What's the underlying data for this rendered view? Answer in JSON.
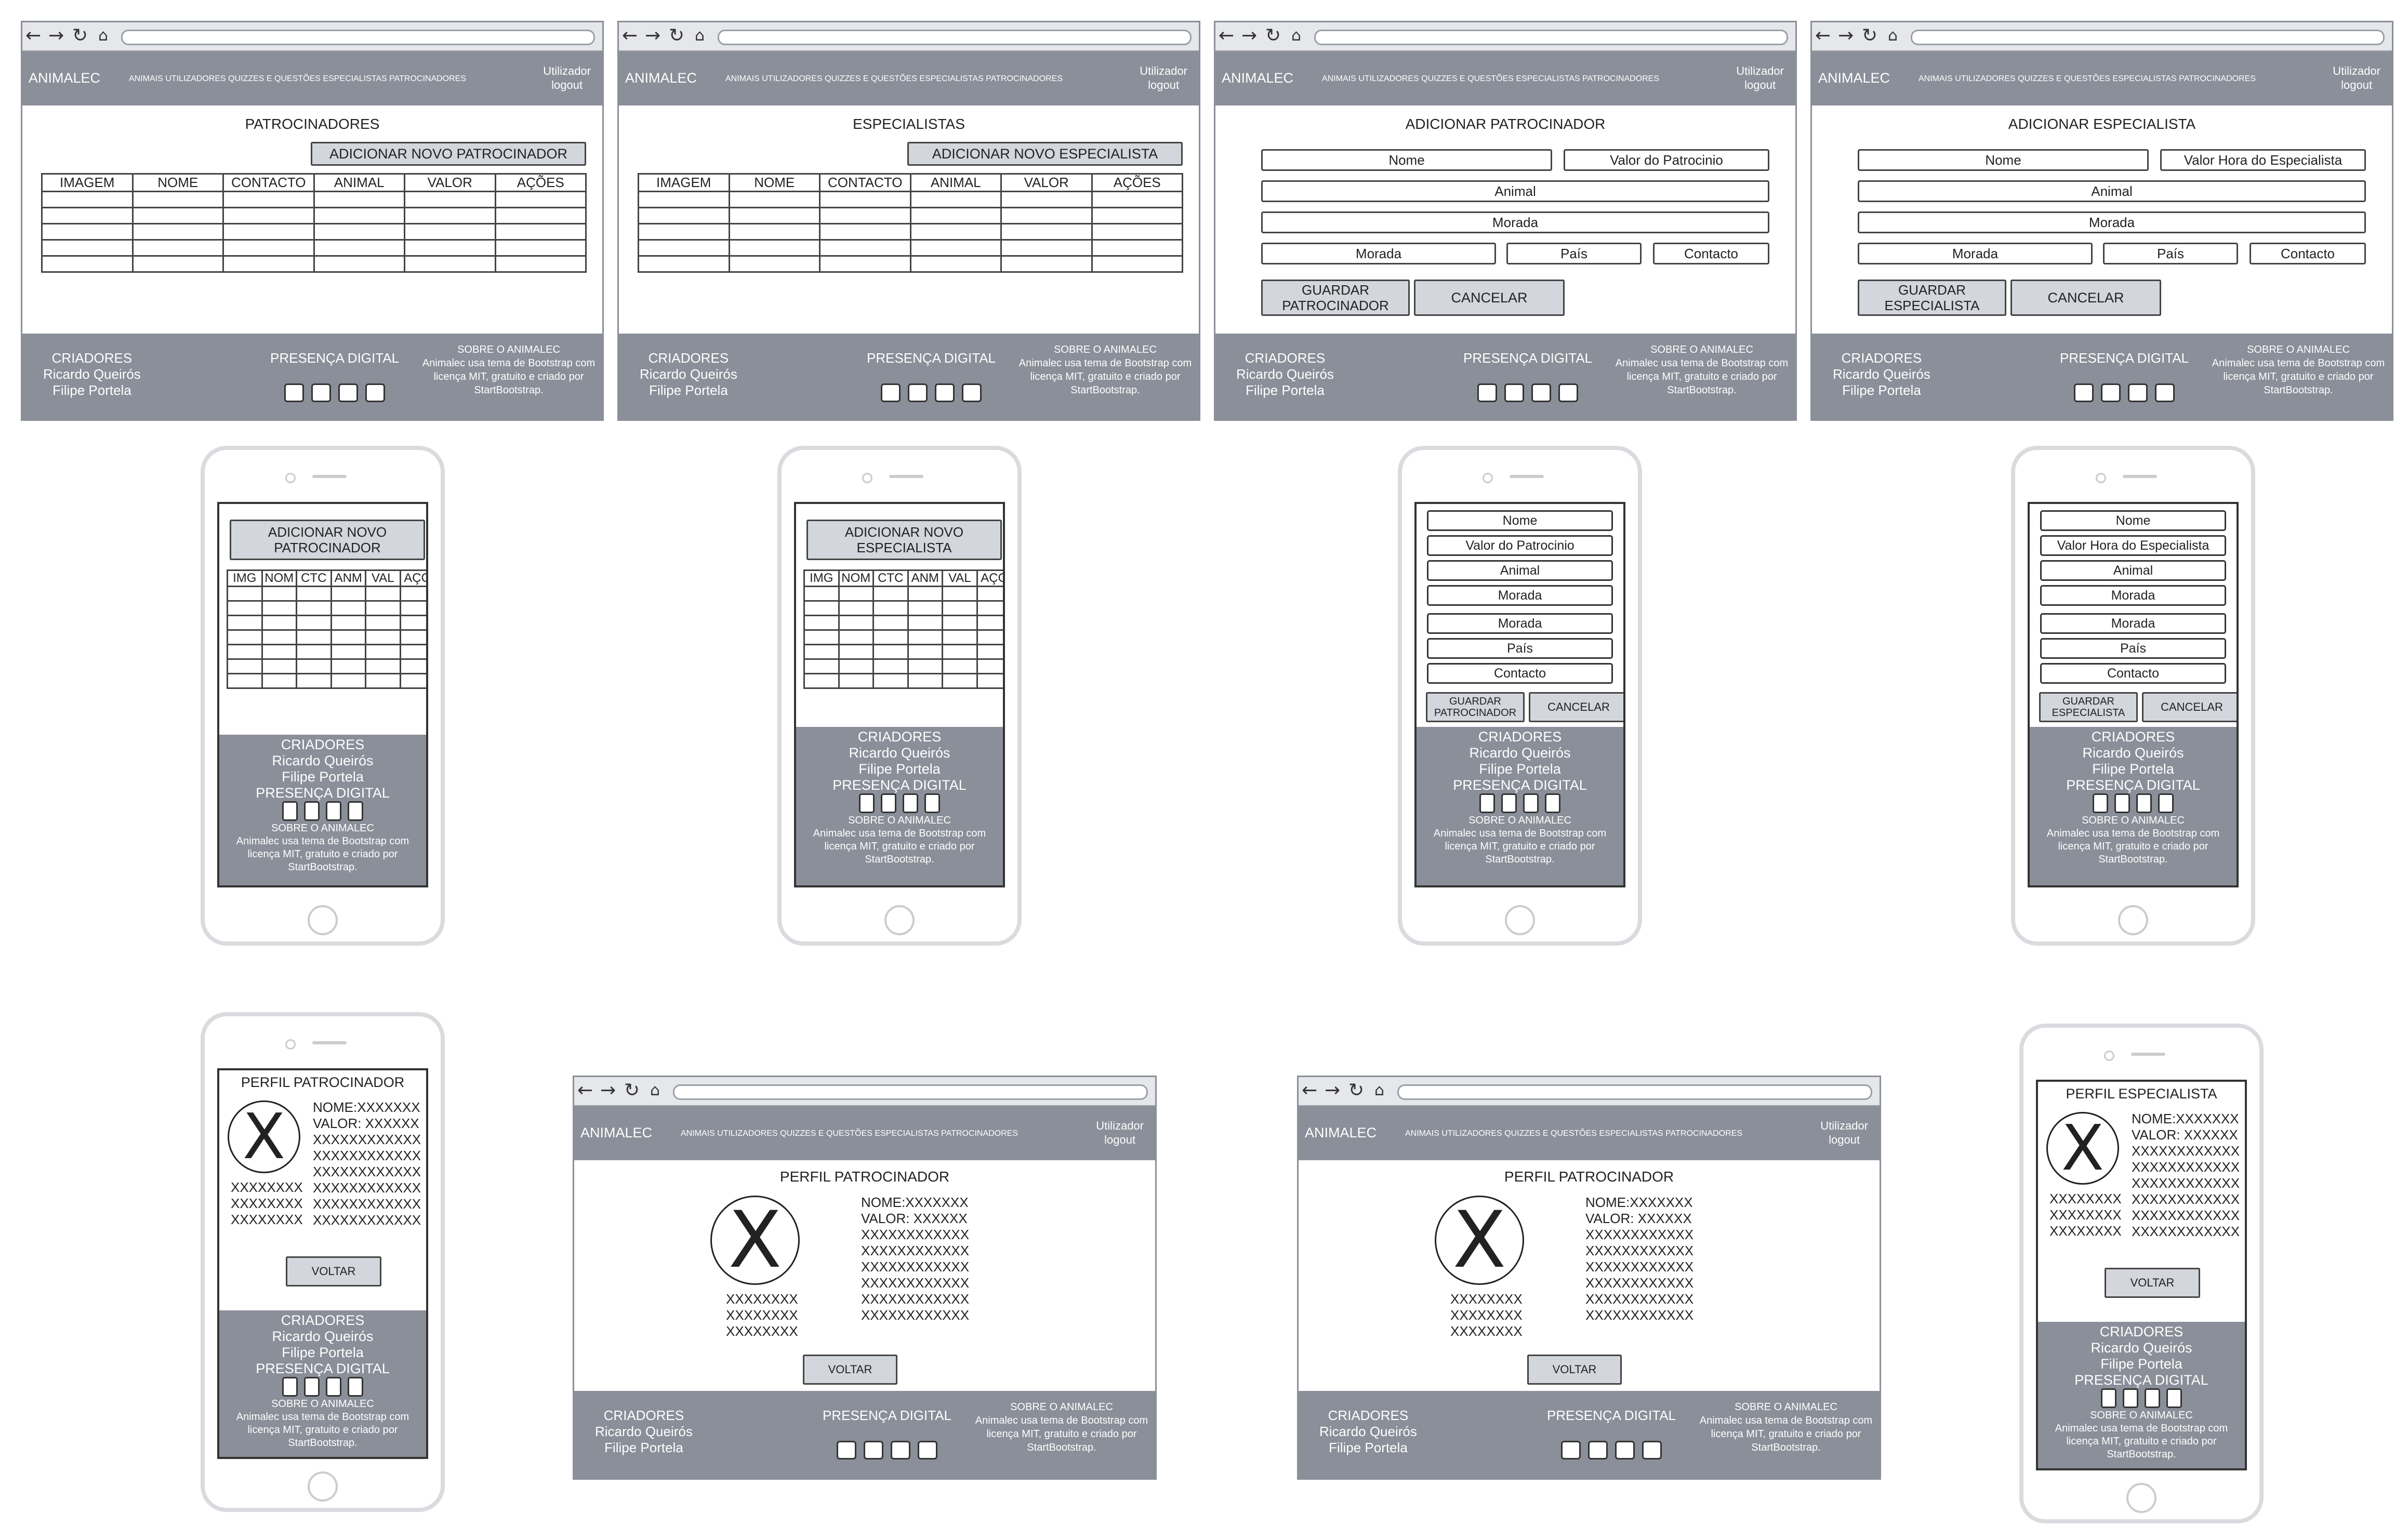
{
  "nav": {
    "brand": "ANIMALEC",
    "menu": "ANIMAIS UTILIZADORES QUIZZES E QUESTÕES ESPECIALISTAS PATROCINADORES",
    "user": "Utilizador",
    "logout": "logout"
  },
  "footer": {
    "criadores": "CRIADORES",
    "author1": "Ricardo Queirós",
    "author2": "Filipe Portela",
    "presenca": "PRESENÇA DIGITAL",
    "sobre": "SOBRE O ANIMALEC",
    "sobre_text": "Animalec usa tema de Bootstrap com licença MIT, gratuito e criado por StartBootstrap."
  },
  "sponsors_list": {
    "title": "PATROCINADORES",
    "add_button": "ADICIONAR NOVO PATROCINADOR",
    "mobile_add_button": "ADICIONAR NOVO PATROCINADOR"
  },
  "experts_list": {
    "title": "ESPECIALISTAS",
    "add_button": "ADICIONAR NOVO ESPECIALISTA",
    "mobile_add_button": "ADICIONAR NOVO ESPECIALISTA"
  },
  "table_headers": [
    "IMAGEM",
    "NOME",
    "CONTACTO",
    "ANIMAL",
    "VALOR",
    "AÇÕES"
  ],
  "mobile_table_headers": [
    "IMG",
    "NOM",
    "CTC",
    "ANM",
    "VAL",
    "AÇO"
  ],
  "add_sponsor": {
    "title": "ADICIONAR PATROCINADOR",
    "nome": "Nome",
    "valor": "Valor do Patrocinio",
    "animal": "Animal",
    "morada": "Morada",
    "morada2": "Morada",
    "pais": "País",
    "contacto": "Contacto",
    "save": "GUARDAR PATROCINADOR",
    "cancel": "CANCELAR"
  },
  "add_expert": {
    "title": "ADICIONAR ESPECIALISTA",
    "nome": "Nome",
    "valor": "Valor Hora do Especialista",
    "animal": "Animal",
    "morada": "Morada",
    "morada2": "Morada",
    "pais": "País",
    "contacto": "Contacto",
    "save": "GUARDAR ESPECIALISTA",
    "cancel": "CANCELAR"
  },
  "profile_sponsor": {
    "title": "PERFIL PATROCINADOR",
    "avatar": "X",
    "nome": "NOME:XXXXXXX",
    "valor": "VALOR: XXXXXX",
    "line": "XXXXXXXXXXXX",
    "short": "XXXXXXXX",
    "back": "VOLTAR"
  },
  "profile_expert": {
    "title": "PERFIL ESPECIALISTA",
    "avatar": "X",
    "nome": "NOME:XXXXXXX",
    "valor": "VALOR: XXXXXX",
    "line": "XXXXXXXXXXXX",
    "short": "XXXXXXXX",
    "back": "VOLTAR"
  },
  "icons": [
    "back-arrow-icon",
    "forward-arrow-icon",
    "refresh-icon",
    "home-icon",
    "avatar-placeholder-icon"
  ],
  "colors": {
    "bar_gray": "#8a8f99",
    "button_gray": "#d3d6dc",
    "chrome": "#e6e7ea"
  }
}
